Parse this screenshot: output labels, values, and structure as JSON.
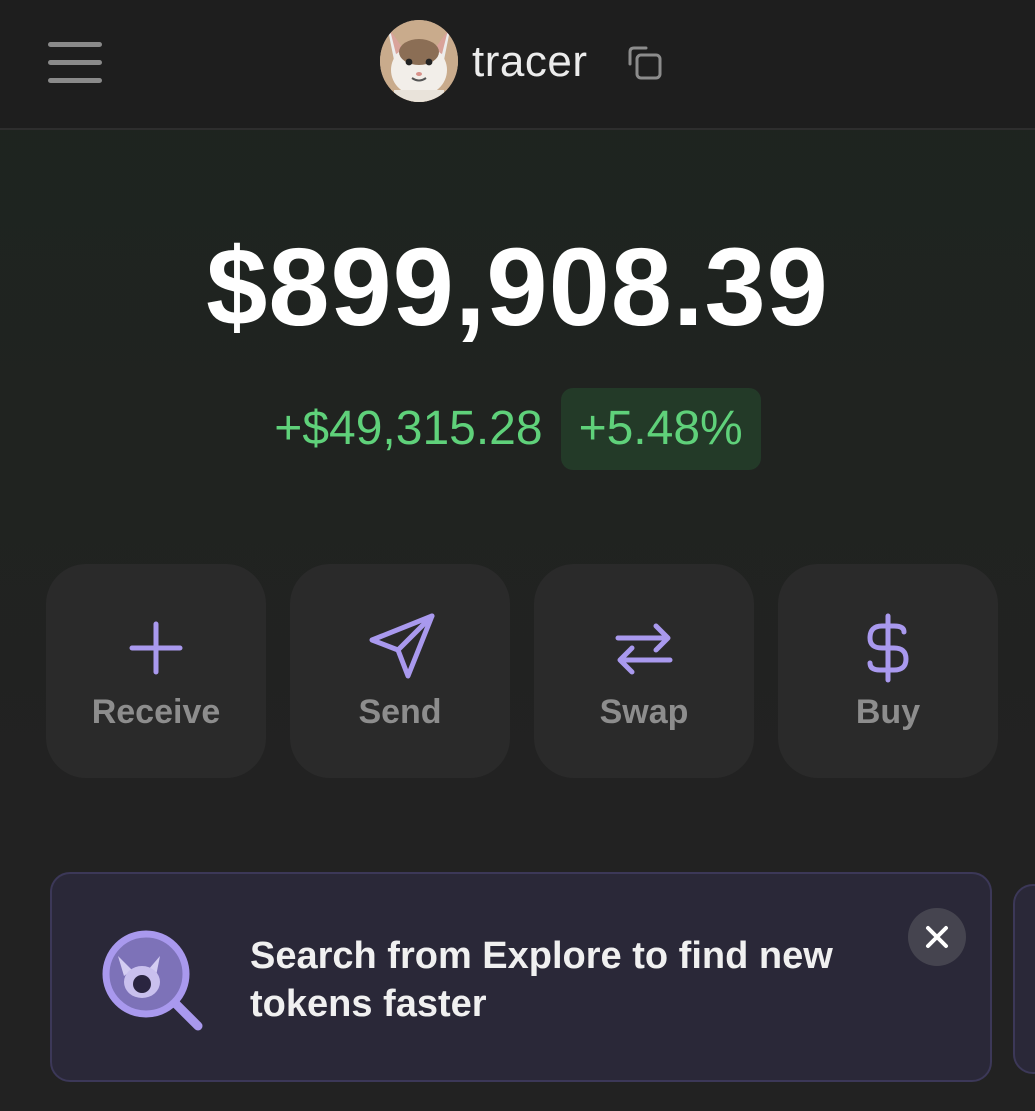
{
  "header": {
    "account_name": "tracer",
    "menu_icon": "hamburger-menu-icon",
    "copy_icon": "copy-icon",
    "avatar": "cat-avatar"
  },
  "portfolio": {
    "balance": "$899,908.39",
    "change_amount": "+$49,315.28",
    "change_percent": "+5.48%"
  },
  "actions": [
    {
      "label": "Receive",
      "icon": "plus-icon"
    },
    {
      "label": "Send",
      "icon": "send-icon"
    },
    {
      "label": "Swap",
      "icon": "swap-arrows-icon"
    },
    {
      "label": "Buy",
      "icon": "dollar-icon"
    }
  ],
  "banner": {
    "text": "Search from Explore to find new tokens faster",
    "icon": "magnifier-cat-icon",
    "close_icon": "close-icon"
  },
  "colors": {
    "accent": "#a999ee",
    "positive": "#5fd17a",
    "positive_bg": "#233a28",
    "card_bg": "#2a2a2a",
    "banner_bg": "#2a2838"
  }
}
